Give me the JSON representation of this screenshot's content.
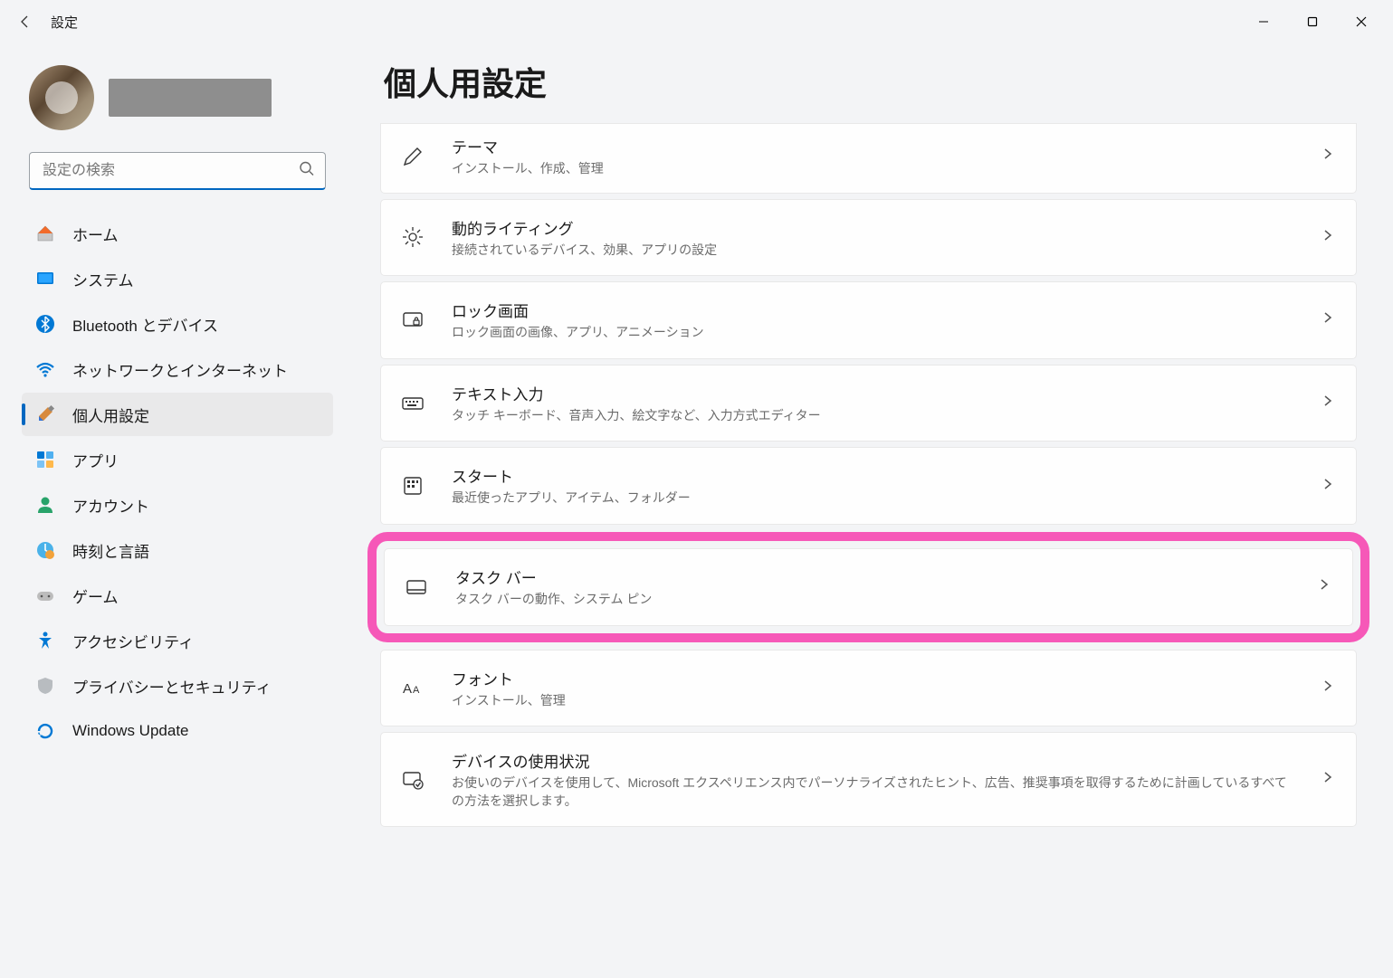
{
  "app": {
    "title": "設定"
  },
  "search": {
    "placeholder": "設定の検索"
  },
  "nav": {
    "items": [
      {
        "label": "ホーム"
      },
      {
        "label": "システム"
      },
      {
        "label": "Bluetooth とデバイス"
      },
      {
        "label": "ネットワークとインターネット"
      },
      {
        "label": "個人用設定"
      },
      {
        "label": "アプリ"
      },
      {
        "label": "アカウント"
      },
      {
        "label": "時刻と言語"
      },
      {
        "label": "ゲーム"
      },
      {
        "label": "アクセシビリティ"
      },
      {
        "label": "プライバシーとセキュリティ"
      },
      {
        "label": "Windows Update"
      }
    ]
  },
  "page": {
    "title": "個人用設定"
  },
  "sections": [
    {
      "title": "テーマ",
      "desc": "インストール、作成、管理"
    },
    {
      "title": "動的ライティング",
      "desc": "接続されているデバイス、効果、アプリの設定"
    },
    {
      "title": "ロック画面",
      "desc": "ロック画面の画像、アプリ、アニメーション"
    },
    {
      "title": "テキスト入力",
      "desc": "タッチ キーボード、音声入力、絵文字など、入力方式エディター"
    },
    {
      "title": "スタート",
      "desc": "最近使ったアプリ、アイテム、フォルダー"
    },
    {
      "title": "タスク バー",
      "desc": "タスク バーの動作、システム ピン"
    },
    {
      "title": "フォント",
      "desc": "インストール、管理"
    },
    {
      "title": "デバイスの使用状況",
      "desc": "お使いのデバイスを使用して、Microsoft エクスペリエンス内でパーソナライズされたヒント、広告、推奨事項を取得するために計画しているすべての方法を選択します。"
    }
  ]
}
